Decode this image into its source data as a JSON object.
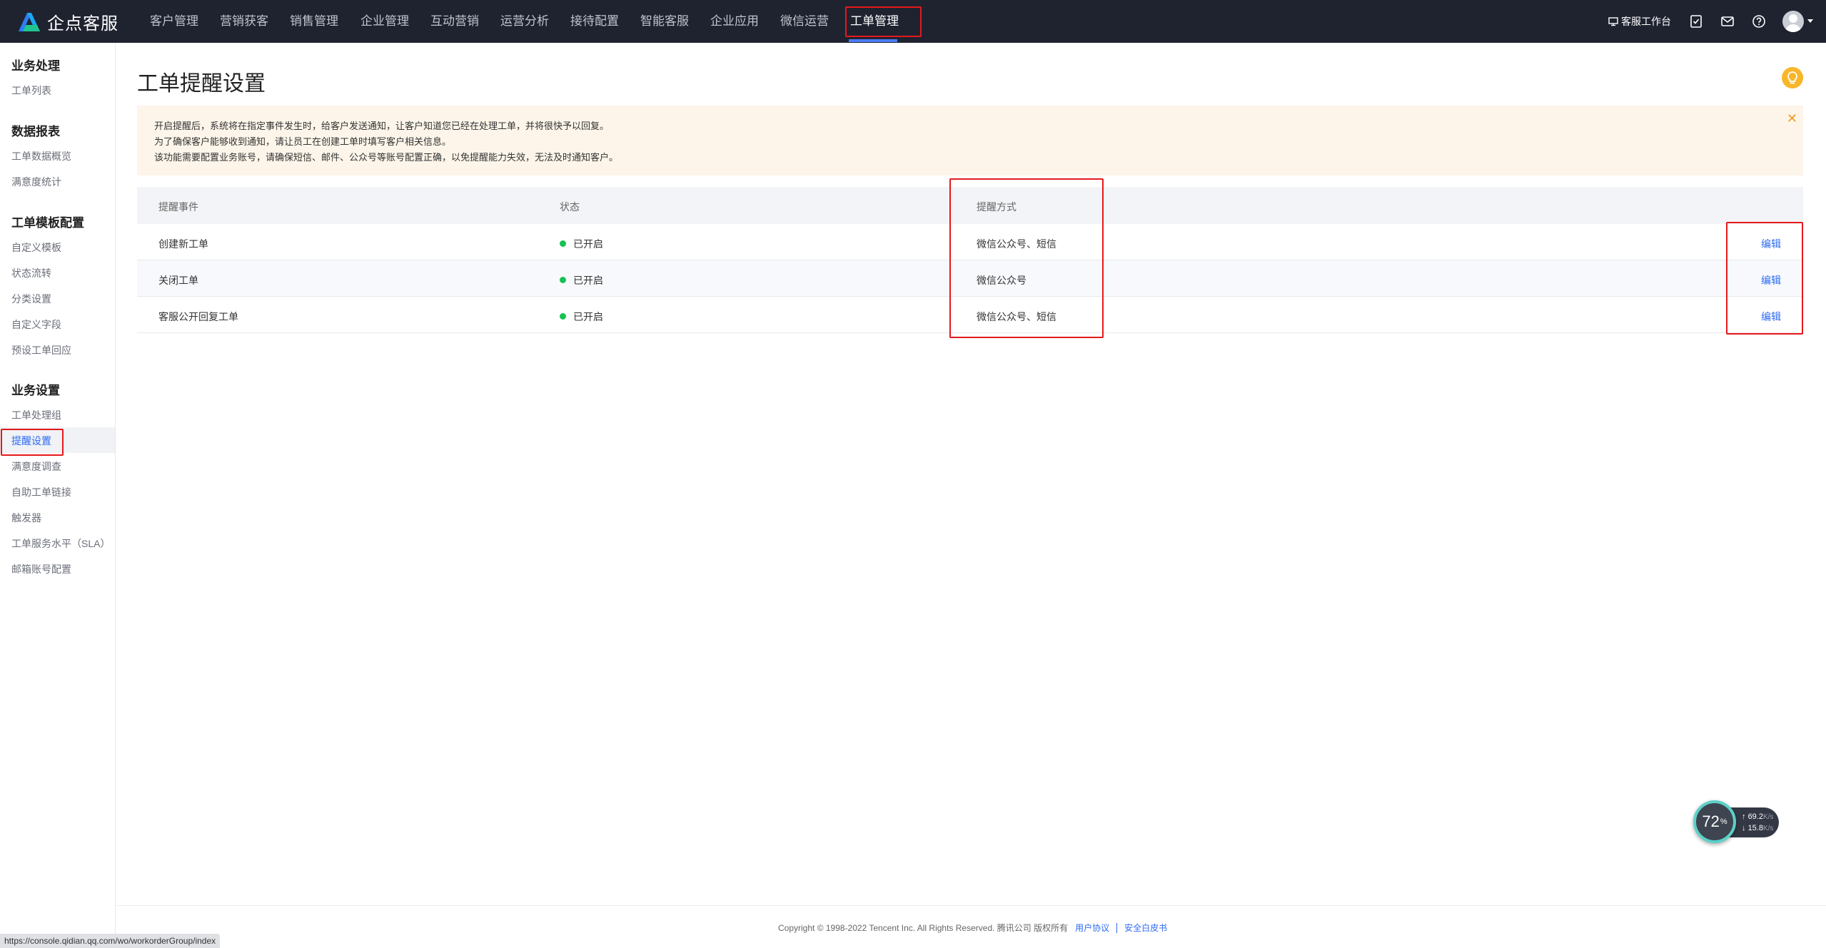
{
  "brand": {
    "name": "企点客服"
  },
  "nav": {
    "items": [
      {
        "label": "客户管理"
      },
      {
        "label": "营销获客"
      },
      {
        "label": "销售管理"
      },
      {
        "label": "企业管理"
      },
      {
        "label": "互动营销"
      },
      {
        "label": "运营分析"
      },
      {
        "label": "接待配置"
      },
      {
        "label": "智能客服"
      },
      {
        "label": "企业应用"
      },
      {
        "label": "微信运营"
      },
      {
        "label": "工单管理"
      }
    ],
    "active": "工单管理"
  },
  "topbar_right": {
    "workstation_label": "客服工作台",
    "icons": [
      "monitor-icon",
      "task-check-icon",
      "mail-icon",
      "help-icon",
      "avatar"
    ]
  },
  "sidebar": {
    "sections": [
      {
        "heading": "业务处理",
        "items": [
          "工单列表"
        ]
      },
      {
        "heading": "数据报表",
        "items": [
          "工单数据概览",
          "满意度统计"
        ]
      },
      {
        "heading": "工单模板配置",
        "items": [
          "自定义模板",
          "状态流转",
          "分类设置",
          "自定义字段",
          "预设工单回应"
        ]
      },
      {
        "heading": "业务设置",
        "items": [
          "工单处理组",
          "提醒设置",
          "满意度调查",
          "自助工单链接",
          "触发器",
          "工单服务水平（SLA）",
          "邮箱账号配置"
        ]
      }
    ],
    "active_item": "提醒设置"
  },
  "page": {
    "title": "工单提醒设置",
    "notice": {
      "lines": [
        "开启提醒后，系统将在指定事件发生时，给客户发送通知，让客户知道您已经在处理工单，并将很快予以回复。",
        "为了确保客户能够收到通知，请让员工在创建工单时填写客户相关信息。",
        "该功能需要配置业务账号，请确保短信、邮件、公众号等账号配置正确，以免提醒能力失效，无法及时通知客户。"
      ],
      "close_icon": "close-icon"
    },
    "table": {
      "headers": [
        "提醒事件",
        "状态",
        "提醒方式",
        ""
      ],
      "rows": [
        {
          "event": "创建新工单",
          "status": "已开启",
          "method": "微信公众号、短信",
          "action": "编辑"
        },
        {
          "event": "关闭工单",
          "status": "已开启",
          "method": "微信公众号",
          "action": "编辑"
        },
        {
          "event": "客服公开回复工单",
          "status": "已开启",
          "method": "微信公众号、短信",
          "action": "编辑"
        }
      ],
      "status_color": "#17c153"
    }
  },
  "footer": {
    "copyright": "Copyright © 1998-2022 Tencent Inc. All Rights Reserved. 腾讯公司 版权所有",
    "links": [
      "用户协议",
      "安全白皮书"
    ]
  },
  "status_url": "https://console.qidian.qq.com/wo/workorderGroup/index",
  "net_widget": {
    "percent": "72",
    "percent_unit": "%",
    "up_speed": "69.2",
    "down_speed": "15.8",
    "unit": "K/s"
  },
  "colors": {
    "topbar_bg": "#1f2330",
    "accent": "#2d6bf3",
    "notice_bg": "#fdf5ea",
    "annotation_red": "#e5191c"
  }
}
